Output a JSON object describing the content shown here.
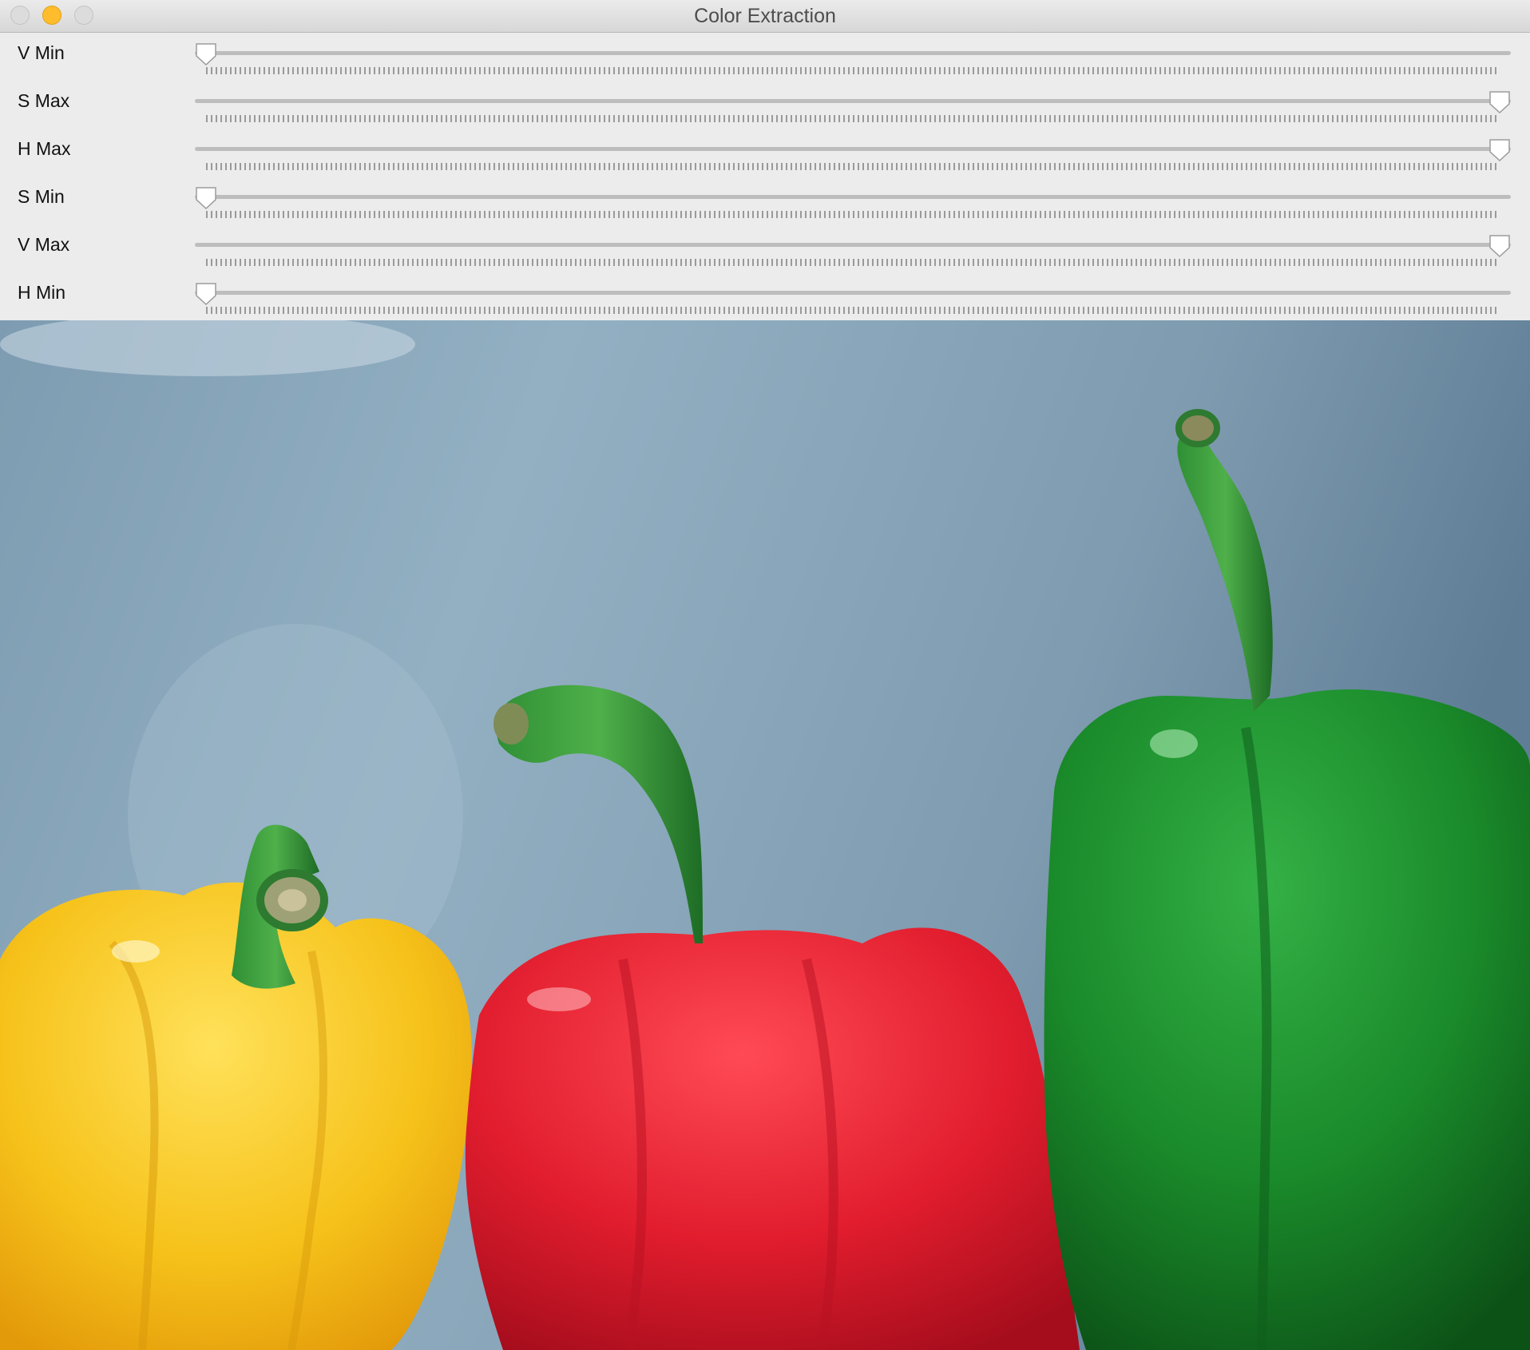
{
  "window": {
    "title": "Color Extraction"
  },
  "sliders": [
    {
      "label": "V Min",
      "value": 0
    },
    {
      "label": "S Max",
      "value": 1
    },
    {
      "label": "H Max",
      "value": 1
    },
    {
      "label": "S Min",
      "value": 0
    },
    {
      "label": "V Max",
      "value": 1
    },
    {
      "label": "H Min",
      "value": 0
    }
  ],
  "image": {
    "subject": "peppers"
  },
  "colors": {
    "yellow_pepper": "#f6c21a",
    "red_pepper": "#e11d2e",
    "green_pepper": "#1a8a2a",
    "background": "#86a6bc"
  }
}
